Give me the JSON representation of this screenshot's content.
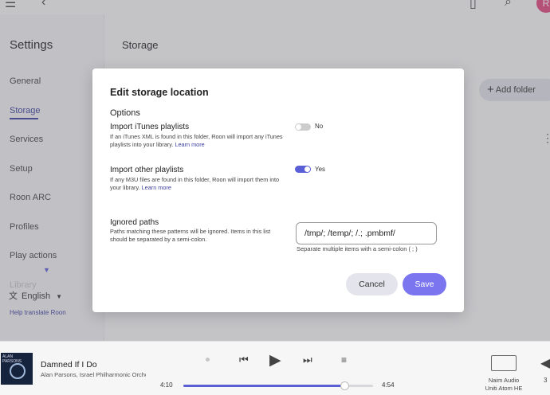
{
  "topbar": {
    "avatar_initial": "R"
  },
  "sidebar": {
    "title": "Settings",
    "items": [
      {
        "label": "General"
      },
      {
        "label": "Storage"
      },
      {
        "label": "Services"
      },
      {
        "label": "Setup"
      },
      {
        "label": "Roon ARC"
      },
      {
        "label": "Profiles"
      },
      {
        "label": "Play actions"
      },
      {
        "label": "Library"
      }
    ],
    "active_item": "Storage",
    "language": "English",
    "help_link": "Help translate Roon"
  },
  "main": {
    "title": "Storage",
    "add_folder_label": "Add folder"
  },
  "dialog": {
    "title": "Edit storage location",
    "options_heading": "Options",
    "itunes": {
      "label": "Import iTunes playlists",
      "description": "If an iTunes XML is found in this folder, Roon will import any iTunes playlists into your library.",
      "learn_more": "Learn more",
      "state": "No"
    },
    "other": {
      "label": "Import other playlists",
      "description": "If any M3U files are found in this folder, Roon will import them into your library.",
      "learn_more": "Learn more",
      "state": "Yes"
    },
    "ignored": {
      "label": "Ignored paths",
      "description": "Paths matching these patterns will be ignored. Items in this list should be separated by a semi-colon.",
      "value": "/tmp/; /temp/; /.; .pmbmf/",
      "hint": "Separate multiple items with a semi-colon ( ; )"
    },
    "cancel_label": "Cancel",
    "save_label": "Save"
  },
  "player": {
    "album_art_text": "ALAN PARSONS",
    "track_title": "Damned If I Do",
    "artists": "Alan Parsons, Israel Philharmonic Orchestra",
    "elapsed": "4:10",
    "duration": "4:54",
    "progress": 0.85,
    "zone_line1": "Naim Audio",
    "zone_line2": "Uniti Atom HE",
    "volume": "3"
  },
  "colors": {
    "accent": "#5b5fd6",
    "nav_active": "#3b3f9e",
    "save_button": "#7b76f0"
  },
  "icons": [
    "menu-icon",
    "back-icon",
    "bookmark-icon",
    "search-icon",
    "plus-icon",
    "more-vertical-icon",
    "chevron-down-icon",
    "translate-icon",
    "caret-down-icon",
    "previous-icon",
    "play-icon",
    "next-icon",
    "queue-icon",
    "device-icon",
    "volume-icon"
  ]
}
